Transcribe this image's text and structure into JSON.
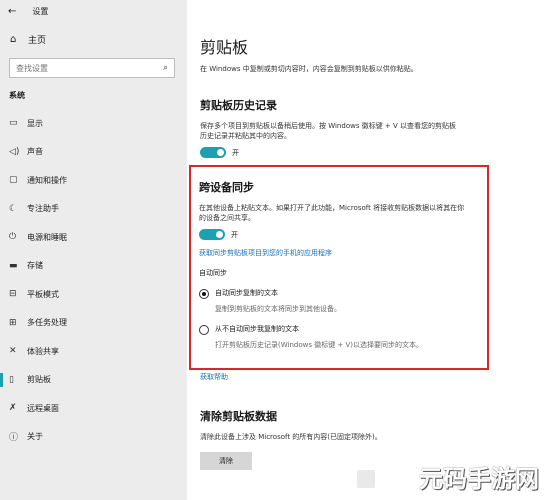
{
  "sidebar": {
    "title": "设置",
    "home": "主页",
    "search_placeholder": "查找设置",
    "section": "系统",
    "items": [
      {
        "label": "显示",
        "icon": "monitor-icon"
      },
      {
        "label": "声音",
        "icon": "sound-icon"
      },
      {
        "label": "通知和操作",
        "icon": "notification-icon"
      },
      {
        "label": "专注助手",
        "icon": "moon-icon"
      },
      {
        "label": "电源和睡眠",
        "icon": "power-icon"
      },
      {
        "label": "存储",
        "icon": "storage-icon"
      },
      {
        "label": "平板模式",
        "icon": "tablet-icon"
      },
      {
        "label": "多任务处理",
        "icon": "multitask-icon"
      },
      {
        "label": "体验共享",
        "icon": "share-icon"
      },
      {
        "label": "剪贴板",
        "icon": "clipboard-icon"
      },
      {
        "label": "远程桌面",
        "icon": "remote-icon"
      },
      {
        "label": "关于",
        "icon": "info-icon"
      }
    ]
  },
  "main": {
    "title": "剪贴板",
    "subtitle": "在 Windows 中复制或剪切内容时，内容会复制到剪贴板以供你粘贴。",
    "history": {
      "heading": "剪贴板历史记录",
      "description": "保存多个项目到剪贴板以备稍后使用。按 Windows 徽标键 + V 以查看您的剪贴板历史记录并粘贴其中的内容。",
      "toggle": "开"
    },
    "sync": {
      "heading": "跨设备同步",
      "description": "在其他设备上粘贴文本。如果打开了此功能，Microsoft 将接收剪贴板数据以将其在你的设备之间共享。",
      "toggle": "开",
      "link": "获取同步剪贴板项目到您的手机的应用程序",
      "auto_label": "自动同步",
      "option1_title": "自动同步复制的文本",
      "option1_desc": "复制到剪贴板的文本将同步到其他设备。",
      "option2_title": "从不自动同步我复制的文本",
      "option2_desc": "打开剪贴板历史记录(Windows 徽标键 + V)以选择要同步的文本。"
    },
    "help_link": "获取帮助",
    "clear": {
      "heading": "清除剪贴板数据",
      "description": "清除此设备上涉及 Microsoft 的所有内容(已固定项除外)。",
      "button": "清除"
    }
  },
  "watermark": "元码手游网"
}
